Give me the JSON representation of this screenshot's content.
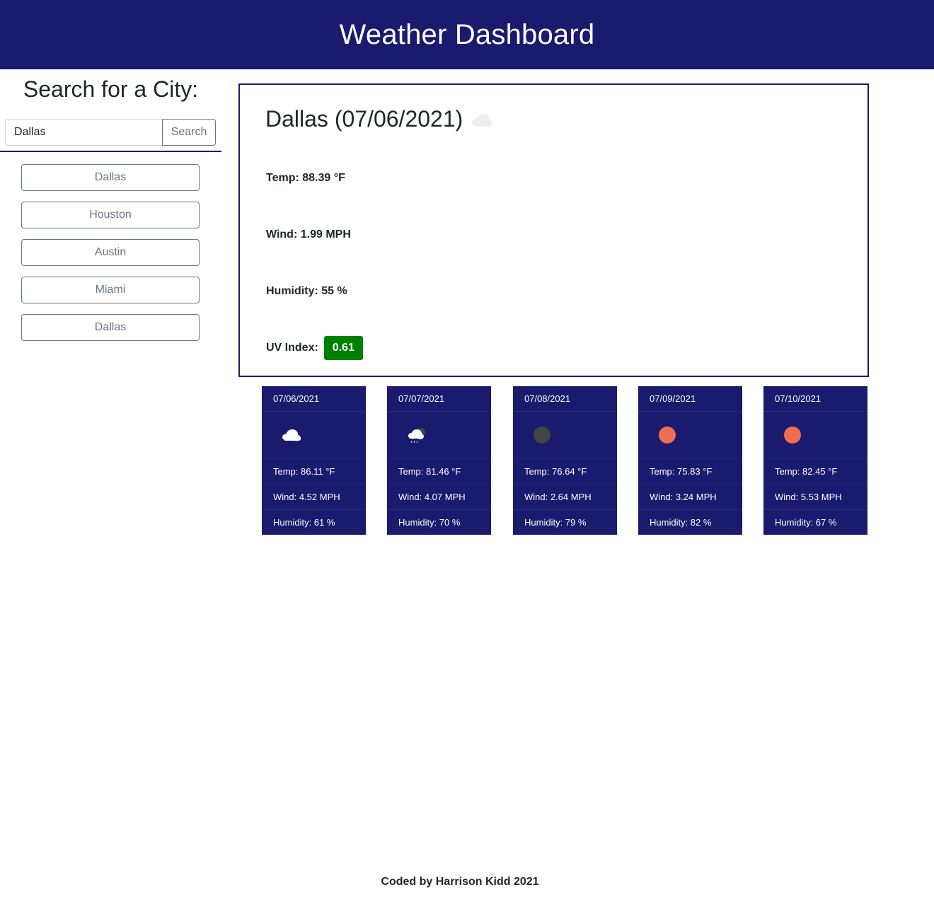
{
  "header": {
    "title": "Weather Dashboard"
  },
  "sidebar": {
    "heading": "Search for a City:",
    "search": {
      "value": "Dallas",
      "placeholder": "",
      "button_label": "Search"
    },
    "history": [
      {
        "label": "Dallas"
      },
      {
        "label": "Houston"
      },
      {
        "label": "Austin"
      },
      {
        "label": "Miami"
      },
      {
        "label": "Dallas"
      }
    ]
  },
  "current": {
    "title": "Dallas (07/06/2021)",
    "icon": "cloud-icon",
    "temp": "Temp: 88.39 °F",
    "wind": "Wind: 1.99 MPH",
    "humidity": "Humidity: 55 %",
    "uv_label": "UV Index:",
    "uv_value": "0.61",
    "uv_color": "#008000"
  },
  "forecast": [
    {
      "date": "07/06/2021",
      "icon": "cloud-icon",
      "temp": "Temp: 86.11 °F",
      "wind": "Wind: 4.52 MPH",
      "humidity": "Humidity: 61 %"
    },
    {
      "date": "07/07/2021",
      "icon": "rain-night-icon",
      "temp": "Temp: 81.46 °F",
      "wind": "Wind: 4.07 MPH",
      "humidity": "Humidity: 70 %"
    },
    {
      "date": "07/08/2021",
      "icon": "night-clear-icon",
      "temp": "Temp: 76.64 °F",
      "wind": "Wind: 2.64 MPH",
      "humidity": "Humidity: 79 %"
    },
    {
      "date": "07/09/2021",
      "icon": "sun-icon",
      "temp": "Temp: 75.83 °F",
      "wind": "Wind: 3.24 MPH",
      "humidity": "Humidity: 82 %"
    },
    {
      "date": "07/10/2021",
      "icon": "sun-icon",
      "temp": "Temp: 82.45 °F",
      "wind": "Wind: 5.53 MPH",
      "humidity": "Humidity: 67 %"
    }
  ],
  "colors": {
    "brand": "#1a1a6e",
    "sun": "#ee6e4f",
    "moon": "#444444"
  },
  "footer": {
    "text": "Coded by Harrison Kidd 2021"
  }
}
